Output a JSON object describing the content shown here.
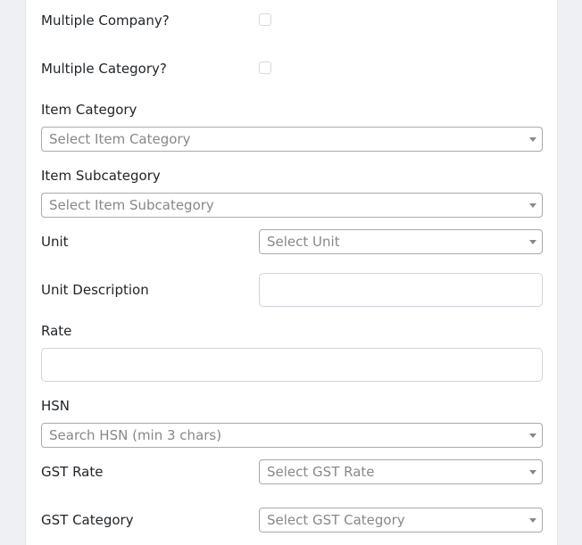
{
  "form": {
    "multiple_company_label": "Multiple Company?",
    "multiple_category_label": "Multiple Category?",
    "item_category_label": "Item Category",
    "item_category_placeholder": "Select Item Category",
    "item_subcategory_label": "Item Subcategory",
    "item_subcategory_placeholder": "Select Item Subcategory",
    "unit_label": "Unit",
    "unit_placeholder": "Select Unit",
    "unit_description_label": "Unit Description",
    "unit_description_value": "",
    "rate_label": "Rate",
    "rate_value": "",
    "hsn_label": "HSN",
    "hsn_placeholder": "Search HSN (min 3 chars)",
    "gst_rate_label": "GST Rate",
    "gst_rate_placeholder": "Select GST Rate",
    "gst_category_label": "GST Category",
    "gst_category_placeholder": "Select GST Category"
  },
  "colors": {
    "page_background": "#eef0f4",
    "card_background": "#ffffff",
    "select_border": "#aaaaaa",
    "placeholder_text": "#888888"
  },
  "icons": {
    "dropdown_arrow": "caret-down-icon"
  }
}
